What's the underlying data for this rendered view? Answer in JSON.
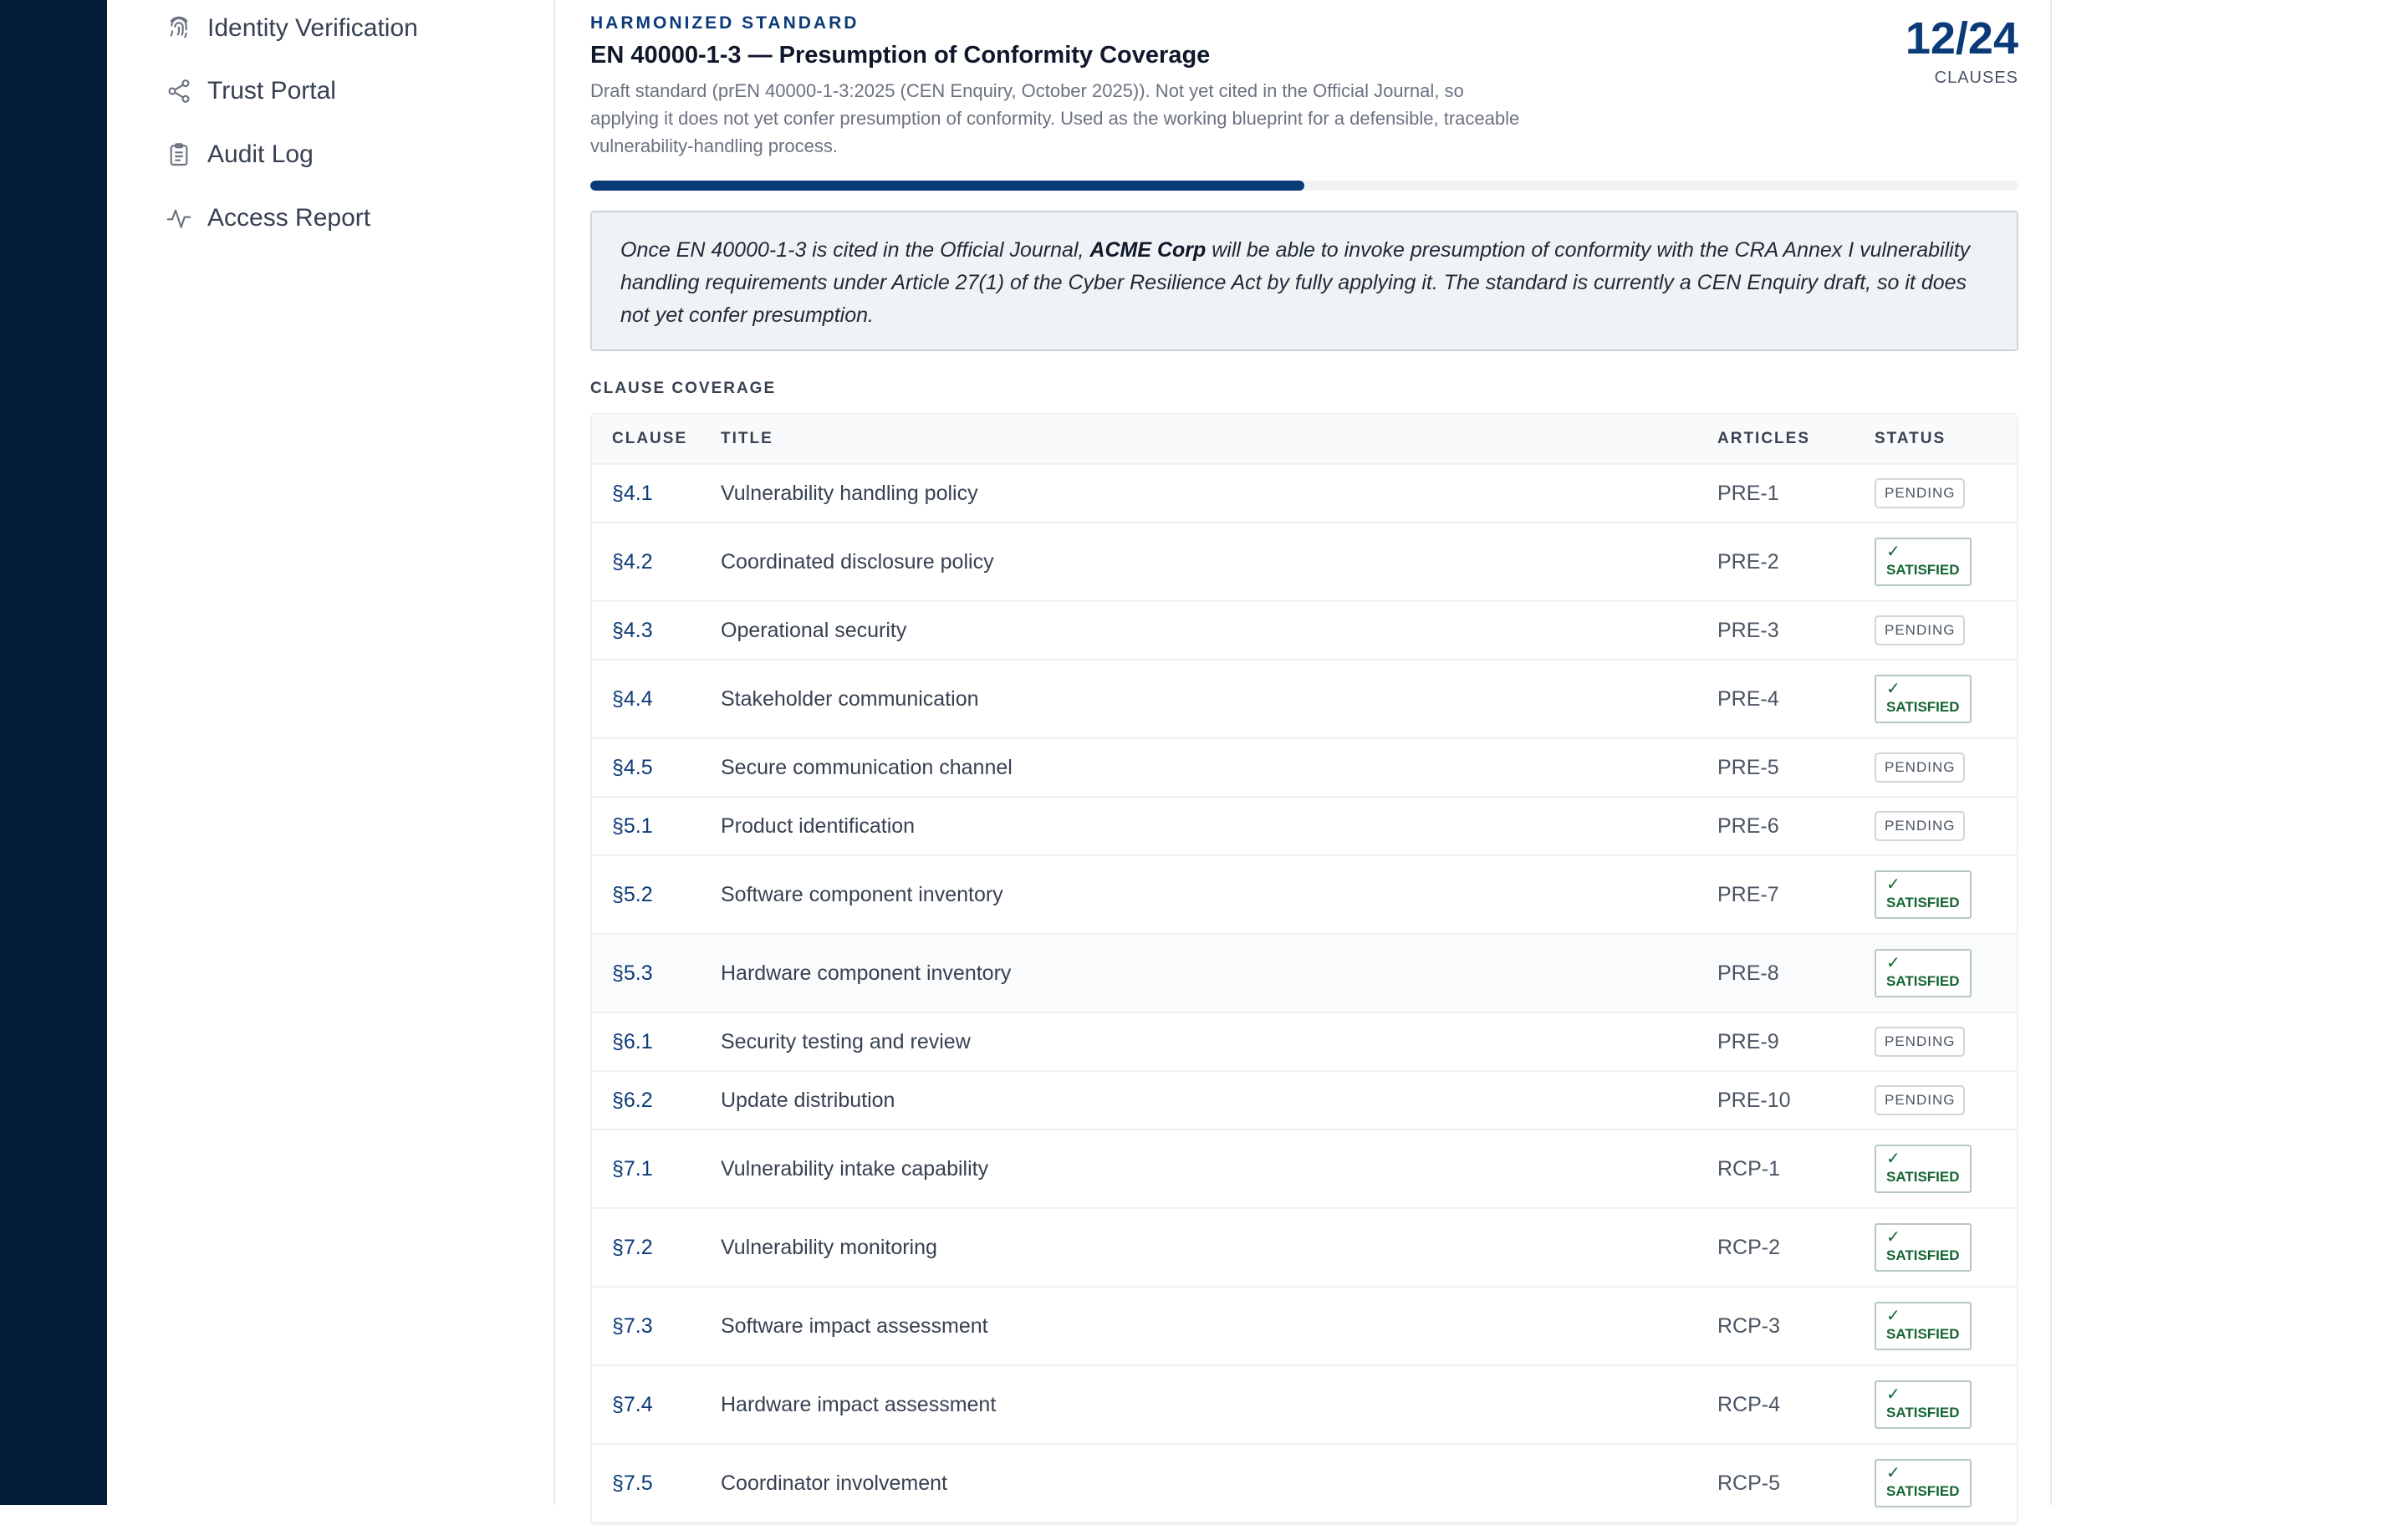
{
  "sidebar": {
    "items": [
      {
        "label": "Identity Verification",
        "icon": "fingerprint-icon"
      },
      {
        "label": "Trust Portal",
        "icon": "share-nodes-icon"
      },
      {
        "label": "Audit Log",
        "icon": "clipboard-icon"
      },
      {
        "label": "Access Report",
        "icon": "activity-icon"
      }
    ]
  },
  "header": {
    "eyebrow": "HARMONIZED STANDARD",
    "title": "EN 40000-1-3 — Presumption of Conformity Coverage",
    "description": "Draft standard (prEN 40000-1-3:2025 (CEN Enquiry, October 2025)). Not yet cited in the Official Journal, so applying it does not yet confer presumption of conformity. Used as the working blueprint for a defensible, traceable vulnerability-handling process.",
    "count": "12/24",
    "count_label": "CLAUSES",
    "progress": 0.5
  },
  "callout": {
    "before": "Once EN 40000-1-3 is cited in the Official Journal, ",
    "org": "ACME Corp",
    "after": " will be able to invoke presumption of conformity with the CRA Annex I vulnerability handling requirements under Article 27(1) of the Cyber Resilience Act by fully applying it. The standard is currently a CEN Enquiry draft, so it does not yet confer presumption."
  },
  "coverage": {
    "section_label": "CLAUSE COVERAGE",
    "columns": [
      "CLAUSE",
      "TITLE",
      "ARTICLES",
      "STATUS"
    ],
    "rows": [
      {
        "clause": "§4.1",
        "title": "Vulnerability handling policy",
        "articles": "PRE-1",
        "status": "PENDING"
      },
      {
        "clause": "§4.2",
        "title": "Coordinated disclosure policy",
        "articles": "PRE-2",
        "status": "SATISFIED"
      },
      {
        "clause": "§4.3",
        "title": "Operational security",
        "articles": "PRE-3",
        "status": "PENDING"
      },
      {
        "clause": "§4.4",
        "title": "Stakeholder communication",
        "articles": "PRE-4",
        "status": "SATISFIED"
      },
      {
        "clause": "§4.5",
        "title": "Secure communication channel",
        "articles": "PRE-5",
        "status": "PENDING"
      },
      {
        "clause": "§5.1",
        "title": "Product identification",
        "articles": "PRE-6",
        "status": "PENDING"
      },
      {
        "clause": "§5.2",
        "title": "Software component inventory",
        "articles": "PRE-7",
        "status": "SATISFIED"
      },
      {
        "clause": "§5.3",
        "title": "Hardware component inventory",
        "articles": "PRE-8",
        "status": "SATISFIED"
      },
      {
        "clause": "§6.1",
        "title": "Security testing and review",
        "articles": "PRE-9",
        "status": "PENDING"
      },
      {
        "clause": "§6.2",
        "title": "Update distribution",
        "articles": "PRE-10",
        "status": "PENDING"
      },
      {
        "clause": "§7.1",
        "title": "Vulnerability intake capability",
        "articles": "RCP-1",
        "status": "SATISFIED"
      },
      {
        "clause": "§7.2",
        "title": "Vulnerability monitoring",
        "articles": "RCP-2",
        "status": "SATISFIED"
      },
      {
        "clause": "§7.3",
        "title": "Software impact assessment",
        "articles": "RCP-3",
        "status": "SATISFIED"
      },
      {
        "clause": "§7.4",
        "title": "Hardware impact assessment",
        "articles": "RCP-4",
        "status": "SATISFIED"
      },
      {
        "clause": "§7.5",
        "title": "Coordinator involvement",
        "articles": "RCP-5",
        "status": "SATISFIED"
      }
    ]
  },
  "colors": {
    "rail": "#041c38",
    "accent": "#0b3a78",
    "satisfied": "#166534"
  }
}
